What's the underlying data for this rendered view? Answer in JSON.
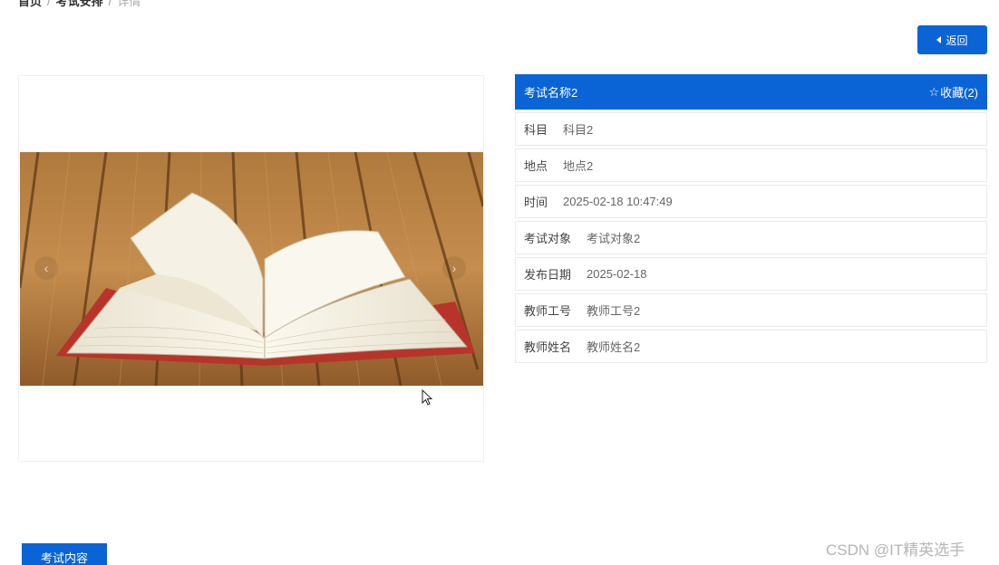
{
  "breadcrumb": {
    "items": [
      "首页",
      "考试安排"
    ],
    "current": "详情",
    "separator": "/"
  },
  "back_button": {
    "label": "返回",
    "icon": "caret-left-icon"
  },
  "carousel": {
    "prev_icon": "‹",
    "next_icon": "›",
    "image_alt": "open book on wooden table"
  },
  "detail": {
    "title": "考试名称2",
    "favorite_label": "收藏(2)",
    "favorite_icon": "☆",
    "rows": [
      {
        "label": "科目",
        "value": "科目2"
      },
      {
        "label": "地点",
        "value": "地点2"
      },
      {
        "label": "时间",
        "value": "2025-02-18 10:47:49"
      },
      {
        "label": "考试对象",
        "value": "考试对象2"
      },
      {
        "label": "发布日期",
        "value": "2025-02-18"
      },
      {
        "label": "教师工号",
        "value": "教师工号2"
      },
      {
        "label": "教师姓名",
        "value": "教师姓名2"
      }
    ]
  },
  "content_tab": {
    "label": "考试内容"
  },
  "watermark": "CSDN @IT精英选手",
  "colors": {
    "accent": "#0a64d6",
    "border": "#e8eaec"
  }
}
